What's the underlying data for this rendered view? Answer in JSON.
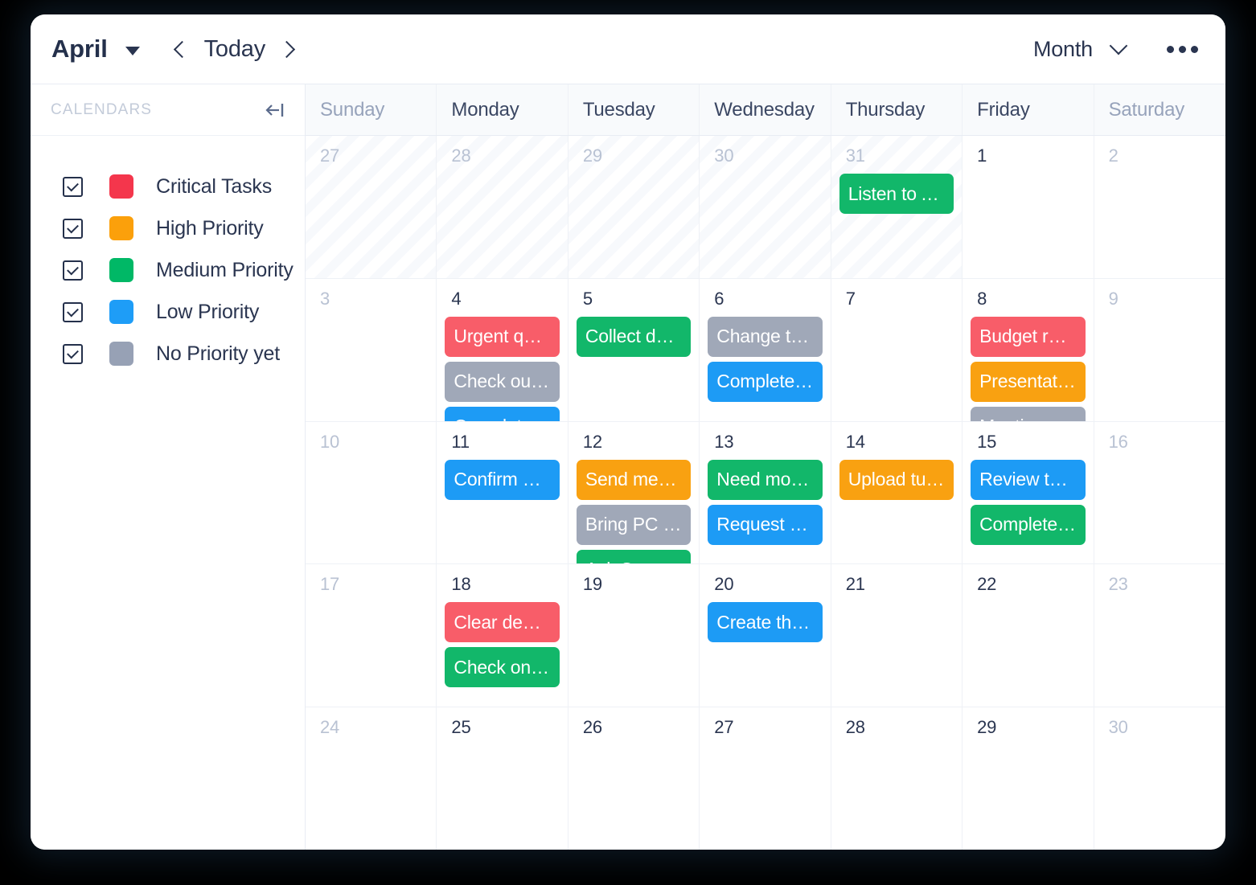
{
  "toolbar": {
    "month": "April",
    "month_caret_icon": "caret-down-icon",
    "prev_icon": "chevron-left-icon",
    "today_label": "Today",
    "next_icon": "chevron-right-icon",
    "view_label": "Month",
    "view_caret_icon": "chevron-down-icon",
    "more_icon": "more-horizontal-icon"
  },
  "sidebar": {
    "title": "CALENDARS",
    "collapse_icon": "collapse-panel-icon",
    "calendars": [
      {
        "label": "Critical Tasks",
        "color": "#f4364c",
        "checked": true
      },
      {
        "label": "High Priority",
        "color": "#fba00b",
        "checked": true
      },
      {
        "label": "Medium Priority",
        "color": "#00b866",
        "checked": true
      },
      {
        "label": "Low Priority",
        "color": "#1e9df7",
        "checked": true
      },
      {
        "label": "No Priority yet",
        "color": "#97a1b5",
        "checked": true
      }
    ]
  },
  "colors": {
    "critical": "#f85d69",
    "high": "#f9a111",
    "medium": "#12b76a",
    "low": "#1d9bf5",
    "none": "#a0a8b8"
  },
  "grid": {
    "weekdays": [
      {
        "label": "Sunday",
        "weekend": true
      },
      {
        "label": "Monday",
        "weekend": false
      },
      {
        "label": "Tuesday",
        "weekend": false
      },
      {
        "label": "Wednesday",
        "weekend": false
      },
      {
        "label": "Thursday",
        "weekend": false
      },
      {
        "label": "Friday",
        "weekend": false
      },
      {
        "label": "Saturday",
        "weekend": true
      }
    ],
    "weeks": [
      [
        {
          "day": "27",
          "out": true,
          "muted": false,
          "events": []
        },
        {
          "day": "28",
          "out": true,
          "muted": false,
          "events": []
        },
        {
          "day": "29",
          "out": true,
          "muted": false,
          "events": []
        },
        {
          "day": "30",
          "out": true,
          "muted": false,
          "events": []
        },
        {
          "day": "31",
          "out": true,
          "muted": false,
          "events": [
            {
              "title": "Listen to Atl...",
              "color": "#12b76a",
              "calendar": "Medium Priority"
            }
          ]
        },
        {
          "day": "1",
          "out": false,
          "muted": false,
          "events": []
        },
        {
          "day": "2",
          "out": false,
          "muted": true,
          "events": []
        }
      ],
      [
        {
          "day": "3",
          "out": false,
          "muted": true,
          "events": []
        },
        {
          "day": "4",
          "out": false,
          "muted": false,
          "events": [
            {
              "title": "Urgent quot...",
              "color": "#f85d69",
              "calendar": "Critical Tasks"
            },
            {
              "title": "Check out t...",
              "color": "#a0a8b8",
              "calendar": "No Priority yet"
            },
            {
              "title": "Complete t...",
              "color": "#1d9bf5",
              "calendar": "Low Priority"
            }
          ]
        },
        {
          "day": "5",
          "out": false,
          "muted": false,
          "events": [
            {
              "title": "Collect deb...",
              "color": "#12b76a",
              "calendar": "Medium Priority"
            }
          ]
        },
        {
          "day": "6",
          "out": false,
          "muted": false,
          "events": [
            {
              "title": "Change the...",
              "color": "#a0a8b8",
              "calendar": "No Priority yet"
            },
            {
              "title": "Complete t...",
              "color": "#1d9bf5",
              "calendar": "Low Priority"
            }
          ]
        },
        {
          "day": "7",
          "out": false,
          "muted": false,
          "events": []
        },
        {
          "day": "8",
          "out": false,
          "muted": false,
          "events": [
            {
              "title": "Budget revi...",
              "color": "#f85d69",
              "calendar": "Critical Tasks"
            },
            {
              "title": "Presentatio...",
              "color": "#f9a111",
              "calendar": "High Priority"
            },
            {
              "title": "Meeting wit...",
              "color": "#a0a8b8",
              "calendar": "No Priority yet"
            }
          ]
        },
        {
          "day": "9",
          "out": false,
          "muted": true,
          "events": []
        }
      ],
      [
        {
          "day": "10",
          "out": false,
          "muted": true,
          "events": []
        },
        {
          "day": "11",
          "out": false,
          "muted": false,
          "events": [
            {
              "title": "Confirm av...",
              "color": "#1d9bf5",
              "calendar": "Low Priority"
            }
          ]
        },
        {
          "day": "12",
          "out": false,
          "muted": false,
          "events": [
            {
              "title": "Send meeti...",
              "color": "#f9a111",
              "calendar": "High Priority"
            },
            {
              "title": "Bring PC ba...",
              "color": "#a0a8b8",
              "calendar": "No Priority yet"
            },
            {
              "title": "Ask Sara fo...",
              "color": "#12b76a",
              "calendar": "Medium Priority"
            }
          ]
        },
        {
          "day": "13",
          "out": false,
          "muted": false,
          "events": [
            {
              "title": "Need more...",
              "color": "#12b76a",
              "calendar": "Medium Priority"
            },
            {
              "title": "Request ap...",
              "color": "#1d9bf5",
              "calendar": "Low Priority"
            }
          ]
        },
        {
          "day": "14",
          "out": false,
          "muted": false,
          "events": [
            {
              "title": "Upload tuto...",
              "color": "#f9a111",
              "calendar": "High Priority"
            }
          ]
        },
        {
          "day": "15",
          "out": false,
          "muted": false,
          "events": [
            {
              "title": "Review the...",
              "color": "#1d9bf5",
              "calendar": "Low Priority"
            },
            {
              "title": "Complete t...",
              "color": "#12b76a",
              "calendar": "Medium Priority"
            }
          ]
        },
        {
          "day": "16",
          "out": false,
          "muted": true,
          "events": []
        }
      ],
      [
        {
          "day": "17",
          "out": false,
          "muted": true,
          "events": []
        },
        {
          "day": "18",
          "out": false,
          "muted": false,
          "events": [
            {
              "title": "Clear demu...",
              "color": "#f85d69",
              "calendar": "Critical Tasks"
            },
            {
              "title": "Check on re...",
              "color": "#12b76a",
              "calendar": "Medium Priority"
            }
          ]
        },
        {
          "day": "19",
          "out": false,
          "muted": false,
          "events": []
        },
        {
          "day": "20",
          "out": false,
          "muted": false,
          "events": [
            {
              "title": "Create the...",
              "color": "#1d9bf5",
              "calendar": "Low Priority"
            }
          ]
        },
        {
          "day": "21",
          "out": false,
          "muted": false,
          "events": []
        },
        {
          "day": "22",
          "out": false,
          "muted": false,
          "events": []
        },
        {
          "day": "23",
          "out": false,
          "muted": true,
          "events": []
        }
      ],
      [
        {
          "day": "24",
          "out": false,
          "muted": true,
          "events": []
        },
        {
          "day": "25",
          "out": false,
          "muted": false,
          "events": []
        },
        {
          "day": "26",
          "out": false,
          "muted": false,
          "events": []
        },
        {
          "day": "27",
          "out": false,
          "muted": false,
          "events": []
        },
        {
          "day": "28",
          "out": false,
          "muted": false,
          "events": []
        },
        {
          "day": "29",
          "out": false,
          "muted": false,
          "events": []
        },
        {
          "day": "30",
          "out": false,
          "muted": true,
          "events": []
        }
      ]
    ]
  }
}
